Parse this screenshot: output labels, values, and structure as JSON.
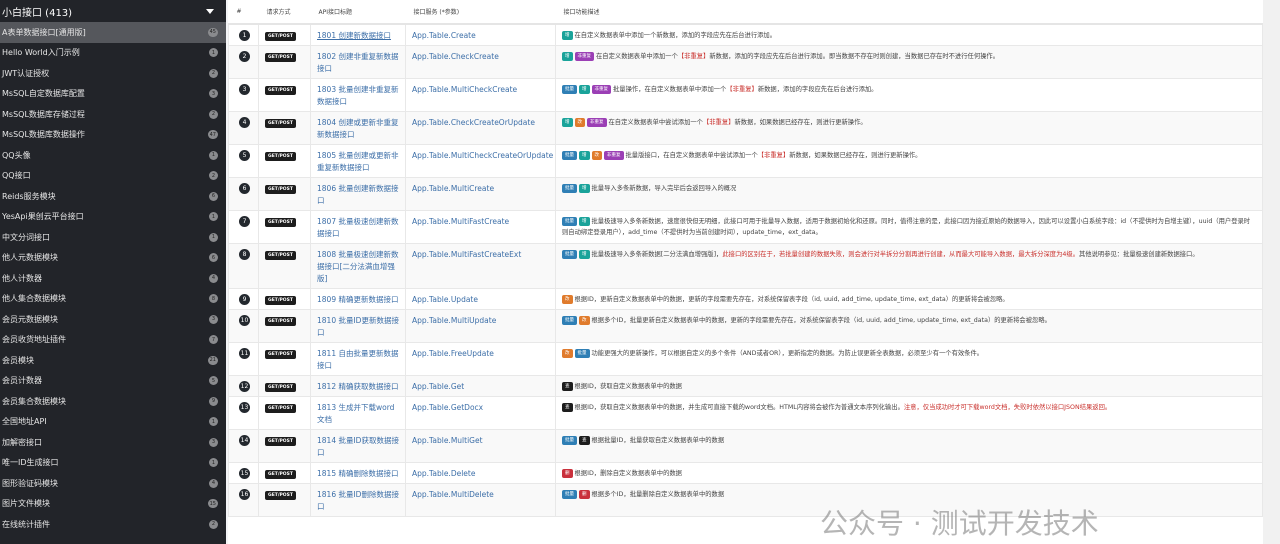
{
  "sidebar": {
    "title": "小白接口 (413)",
    "items": [
      {
        "label": "A表单数据接口[通用版]",
        "count": "45",
        "active": true
      },
      {
        "label": "Hello World入门示例",
        "count": "1"
      },
      {
        "label": "JWT认证授权",
        "count": "2"
      },
      {
        "label": "MsSQL自定数据库配置",
        "count": "3"
      },
      {
        "label": "MsSQL数据库存储过程",
        "count": "2"
      },
      {
        "label": "MsSQL数据库数据操作",
        "count": "47"
      },
      {
        "label": "QQ头像",
        "count": "1"
      },
      {
        "label": "QQ接口",
        "count": "2"
      },
      {
        "label": "Reids服务模块",
        "count": "6"
      },
      {
        "label": "YesApi果创云平台接口",
        "count": "1"
      },
      {
        "label": "中文分词接口",
        "count": "1"
      },
      {
        "label": "他人元数据模块",
        "count": "6"
      },
      {
        "label": "他人计数器",
        "count": "4"
      },
      {
        "label": "他人集合数据模块",
        "count": "8"
      },
      {
        "label": "会员元数据模块",
        "count": "3"
      },
      {
        "label": "会员收货地址插件",
        "count": "7"
      },
      {
        "label": "会员模块",
        "count": "21"
      },
      {
        "label": "会员计数器",
        "count": "5"
      },
      {
        "label": "会员集合数据模块",
        "count": "9"
      },
      {
        "label": "全国地址API",
        "count": "1"
      },
      {
        "label": "加解密接口",
        "count": "3"
      },
      {
        "label": "唯一ID生成接口",
        "count": "1"
      },
      {
        "label": "图形验证码模块",
        "count": "4"
      },
      {
        "label": "图片文件模块",
        "count": "15"
      },
      {
        "label": "在线统计插件",
        "count": "2"
      }
    ]
  },
  "table": {
    "headers": [
      "#",
      "请求方式",
      "API接口标题",
      "接口服务 (*参数)",
      "接口功能描述"
    ],
    "tag_colors": {
      "增": "#1aa39a",
      "改": "#e07b2c",
      "非重复": "#9b3fb5",
      "批量": "#2f7fb5",
      "查": "#1d1d1d",
      "删": "#c9303c"
    },
    "rows": [
      {
        "n": "1",
        "method": "GET/POST",
        "title": "1801 创建新数据接口",
        "service": "App.Table.Create",
        "tags": [
          "增"
        ],
        "desc": "在自定义数据表单中添加一个新数据，添加的字段应先在后台进行添加。",
        "red": "",
        "tail": ""
      },
      {
        "n": "2",
        "method": "GET/POST",
        "title": "1802 创建非重复新数据接口",
        "service": "App.Table.CheckCreate",
        "tags": [
          "增",
          "非重复"
        ],
        "desc": "在自定义数据表单中添加一个",
        "red": "【非重复】",
        "tail": "新数据，添加的字段应先在后台进行添加。即当数据不存在时则创建，当数据已存在时不进行任何操作。"
      },
      {
        "n": "3",
        "method": "GET/POST",
        "title": "1803 批量创建非重复新数据接口",
        "service": "App.Table.MultiCheckCreate",
        "tags": [
          "批量",
          "增",
          "非重复"
        ],
        "desc": "批量操作，在自定义数据表单中添加一个",
        "red": "【非重复】",
        "tail": "新数据，添加的字段应先在后台进行添加。"
      },
      {
        "n": "4",
        "method": "GET/POST",
        "title": "1804 创建或更新非重复新数据接口",
        "service": "App.Table.CheckCreateOrUpdate",
        "tags": [
          "增",
          "改",
          "非重复"
        ],
        "desc": "在自定义数据表单中尝试添加一个",
        "red": "【非重复】",
        "tail": "新数据，如果数据已经存在，则进行更新操作。"
      },
      {
        "n": "5",
        "method": "GET/POST",
        "title": "1805 批量创建或更新非重复新数据接口",
        "service": "App.Table.MultiCheckCreateOrUpdate",
        "tags": [
          "批量",
          "增",
          "改",
          "非重复"
        ],
        "desc": "批量版接口，在自定义数据表单中尝试添加一个",
        "red": "【非重复】",
        "tail": "新数据，如果数据已经存在，则进行更新操作。"
      },
      {
        "n": "6",
        "method": "GET/POST",
        "title": "1806 批量创建新数据接口",
        "service": "App.Table.MultiCreate",
        "tags": [
          "批量",
          "增"
        ],
        "desc": "批量导入多条新数据，导入完毕后会返回导入的概况",
        "red": "",
        "tail": ""
      },
      {
        "n": "7",
        "method": "GET/POST",
        "title": "1807 批量极速创建新数据接口",
        "service": "App.Table.MultiFastCreate",
        "tags": [
          "批量",
          "增"
        ],
        "desc": "批量极速导入多条新数据，速度很快但无明细，此接口可用于批量导入数据，适用于数据初始化和还原。同时，值得注意的是，此接口因为接近原始的数据导入，因此可以设置小白系统字段：id（不提供时为自增主键），uuid（用户登录时则自动绑定登录用户），add_time（不提供时为当前创建时间），update_time，ext_data。",
        "red": "",
        "tail": ""
      },
      {
        "n": "8",
        "method": "GET/POST",
        "title": "1808 批量极速创建新数据接口[二分法满血增强版]",
        "service": "App.Table.MultiFastCreateExt",
        "tags": [
          "批量",
          "增"
        ],
        "desc": "批量极速导入多条新数据[二分法满血增强版]，",
        "red": "此接口的区别在于，若批量创建的数据失败，则会进行对半拆分分割再进行创建，从而最大可能导入数据，最大拆分深度为4级。",
        "tail": "其他说明参见：批量极速创建新数据接口。"
      },
      {
        "n": "9",
        "method": "GET/POST",
        "title": "1809 精确更新数据接口",
        "service": "App.Table.Update",
        "tags": [
          "改"
        ],
        "desc": "根据ID，更新自定义数据表单中的数据，更新的字段需要先存在，对系统保留表字段（id, uuid, add_time, update_time, ext_data）的更新将会被忽略。",
        "red": "",
        "tail": ""
      },
      {
        "n": "10",
        "method": "GET/POST",
        "title": "1810 批量ID更新数据接口",
        "service": "App.Table.MultiUpdate",
        "tags": [
          "批量",
          "改"
        ],
        "desc": "根据多个ID，批量更新自定义数据表单中的数据，更新的字段需要先存在，对系统保留表字段（id, uuid, add_time, update_time, ext_data）的更新将会被忽略。",
        "red": "",
        "tail": ""
      },
      {
        "n": "11",
        "method": "GET/POST",
        "title": "1811 自由批量更新数据接口",
        "service": "App.Table.FreeUpdate",
        "tags": [
          "改",
          "批量"
        ],
        "desc": "功能更强大的更新操作，可以根据自定义的多个条件（AND或者OR），更新指定的数据。为防止误更新全表数据，必须至少有一个有效条件。",
        "red": "",
        "tail": ""
      },
      {
        "n": "12",
        "method": "GET/POST",
        "title": "1812 精确获取数据接口",
        "service": "App.Table.Get",
        "tags": [
          "查"
        ],
        "desc": "根据ID，获取自定义数据表单中的数据",
        "red": "",
        "tail": ""
      },
      {
        "n": "13",
        "method": "GET/POST",
        "title": "1813 生成并下载word文档",
        "service": "App.Table.GetDocx",
        "tags": [
          "查"
        ],
        "desc": "根据ID，获取自定义数据表单中的数据，并生成可直接下载的word文档。HTML内容将会被作为普通文本序列化输出。",
        "red": "注意，仅当成功时才可下载word文档，失败时依然以接口JSON结果返回。",
        "tail": ""
      },
      {
        "n": "14",
        "method": "GET/POST",
        "title": "1814 批量ID获取数据接口",
        "service": "App.Table.MultiGet",
        "tags": [
          "批量",
          "查"
        ],
        "desc": "根据批量ID，批量获取自定义数据表单中的数据",
        "red": "",
        "tail": ""
      },
      {
        "n": "15",
        "method": "GET/POST",
        "title": "1815 精确删除数据接口",
        "service": "App.Table.Delete",
        "tags": [
          "删"
        ],
        "desc": "根据ID，删除自定义数据表单中的数据",
        "red": "",
        "tail": ""
      },
      {
        "n": "16",
        "method": "GET/POST",
        "title": "1816 批量ID删除数据接口",
        "service": "App.Table.MultiDelete",
        "tags": [
          "批量",
          "删"
        ],
        "desc": "根据多个ID，批量删除自定义数据表单中的数据",
        "red": "",
        "tail": ""
      }
    ]
  },
  "watermark": "公众号 · 测试开发技术"
}
